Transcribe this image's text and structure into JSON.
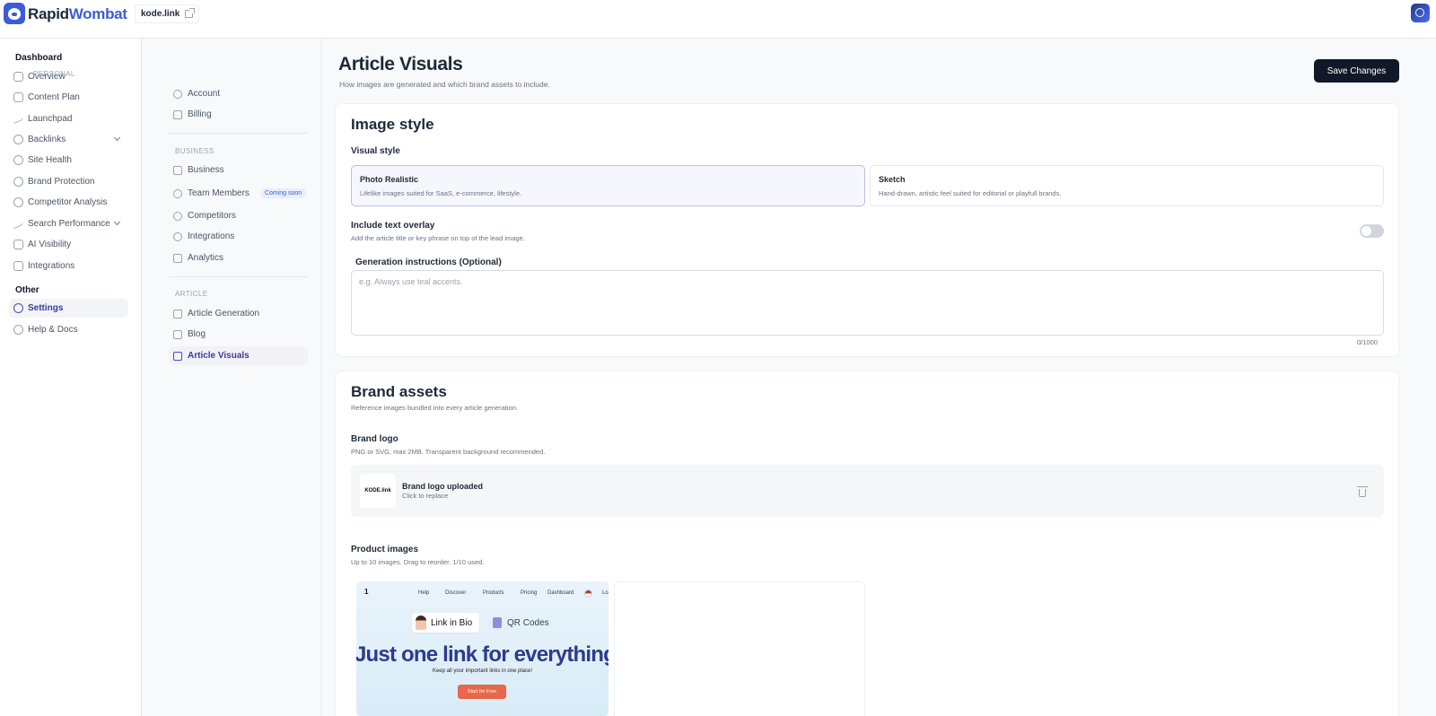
{
  "brand": {
    "name_part1": "Rapid",
    "name_part2": "Wombat",
    "accent": "#3b5bdb"
  },
  "site": {
    "domain": "kode.link"
  },
  "sidebar": {
    "group_dashboard": "Dashboard",
    "group_other": "Other",
    "items": [
      {
        "label": "Overview",
        "icon": "home-icon"
      },
      {
        "label": "Content Plan",
        "icon": "calendar-icon"
      },
      {
        "label": "Launchpad",
        "icon": "trend-icon"
      },
      {
        "label": "Backlinks",
        "icon": "link-icon"
      },
      {
        "label": "Site Health",
        "icon": "magnify-icon"
      },
      {
        "label": "Brand Protection",
        "icon": "shield-icon"
      },
      {
        "label": "Competitor Analysis",
        "icon": "pie-icon"
      },
      {
        "label": "Search Performance",
        "icon": "chart-icon"
      },
      {
        "label": "AI Visibility",
        "icon": "sparkle-icon"
      },
      {
        "label": "Integrations",
        "icon": "plug-icon"
      }
    ],
    "other_items": [
      {
        "label": "Settings",
        "icon": "gear-icon"
      },
      {
        "label": "Help & Docs",
        "icon": "help-icon"
      }
    ]
  },
  "settings_nav": {
    "personal": "PERSONAL",
    "business": "BUSINESS",
    "article": "ARTICLE",
    "account": "Account",
    "billing": "Billing",
    "business_item": "Business",
    "team_members": "Team Members",
    "coming_soon": "Coming soon",
    "competitors": "Competitors",
    "integrations": "Integrations",
    "analytics": "Analytics",
    "article_generation": "Article Generation",
    "blog": "Blog",
    "article_visuals": "Article Visuals"
  },
  "page": {
    "title": "Article Visuals",
    "subtitle": "How images are generated and which brand assets to include.",
    "save_label": "Save Changes"
  },
  "image_style": {
    "title": "Image style",
    "visual_style_label": "Visual style",
    "options": [
      {
        "title": "Photo Realistic",
        "desc": "Lifelike images suited for SaaS, e-commerce, lifestyle.",
        "selected": true
      },
      {
        "title": "Sketch",
        "desc": "Hand-drawn, artistic feel suited for editorial or playfull brands.",
        "selected": false
      }
    ],
    "overlay_label": "Include text overlay",
    "overlay_hint": "Add the article title or key phrase on top of the lead image.",
    "overlay_on": false,
    "instructions_label": "Generation instructions (Optional)",
    "instructions_placeholder": "e.g. Always use teal accents.",
    "counter": "0/1000"
  },
  "brand_assets": {
    "title": "Brand assets",
    "subtitle": "Reference images bundled into every article generation.",
    "logo_label": "Brand logo",
    "logo_hint": "PNG or SVG, max 2MB. Transparent background recommended.",
    "logo_thumb_text": "KODE.link",
    "logo_status": "Brand logo uploaded",
    "logo_action": "Click to replace",
    "product_label": "Product images",
    "product_hint": "Up to 10 images. Drag to reorder. 1/10 used.",
    "product_preview": {
      "number": "1",
      "nav": [
        "Help",
        "Discover",
        "Products",
        "Pricing",
        "Dashboard"
      ],
      "nav_login": "Lo",
      "chip_link": "Link in Bio",
      "chip_qr": "QR Codes",
      "hero": "Just one link for everything",
      "sub": "Keep all your important links in one place!",
      "cta": "Start for Free"
    }
  }
}
